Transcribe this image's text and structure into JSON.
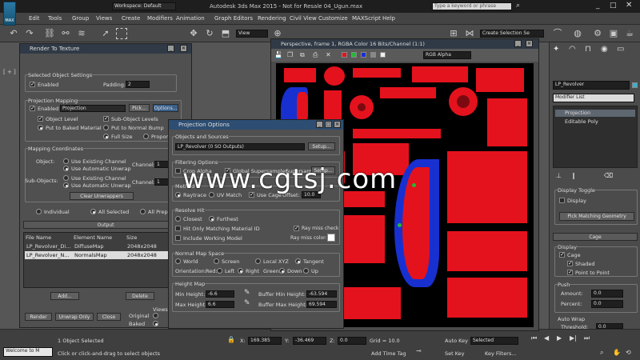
{
  "app": {
    "title": "Autodesk 3ds Max 2015 - Not for Resale   04_Ugun.max",
    "workspace": "Workspace: Default",
    "search_placeholder": "Type a keyword or phrase",
    "logo_text": "MAX"
  },
  "menu": [
    "Edit",
    "Tools",
    "Group",
    "Views",
    "Create",
    "Modifiers",
    "Animation",
    "Graph Editors",
    "Rendering",
    "Civil View",
    "Customize",
    "MAXScript",
    "Help"
  ],
  "toolbar": {
    "view_dropdown": "View",
    "selection_set": "Create Selection Se"
  },
  "rtt": {
    "title": "Render To Texture",
    "selected_settings_label": "Selected Object Settings",
    "enabled_label": "Enabled",
    "padding_label": "Padding:",
    "padding_value": "2",
    "projection_label": "Projection Mapping",
    "projection_enabled": "Enabled",
    "projection_value": "Projection",
    "pick_label": "Pick...",
    "options_label": "Options...",
    "object_level": "Object Level",
    "sub_object_levels": "Sub-Object Levels",
    "put_to_baked": "Put to Baked Material",
    "put_to_normal": "Put to Normal Bump",
    "full_size": "Full Size",
    "proportional": "Proportional",
    "mapping_coords_label": "Mapping Coordinates",
    "object_label": "Object:",
    "subobjects_label": "Sub-Objects:",
    "use_existing_channel": "Use Existing Channel",
    "use_auto_unwrap": "Use Automatic Unwrap",
    "channel_label": "Channel:",
    "channel_value": "1",
    "clear_unwrappers": "Clear Unwrappers",
    "individual": "Individual",
    "all_selected": "All Selected",
    "all_prepared": "All Prepared",
    "output_label": "Output",
    "table_headers": [
      "File Name",
      "Element Name",
      "Size"
    ],
    "table_rows": [
      [
        "LP_Revolver_Di...",
        "DiffuseMap",
        "2048x2048"
      ],
      [
        "LP_Revolver_N...",
        "NormalsMap",
        "2048x2048"
      ]
    ],
    "add_label": "Add...",
    "delete_label": "Delete",
    "views_label": "Views",
    "original_label": "Original",
    "baked_label": "Baked",
    "render_label": "Render",
    "unwrap_only": "Unwrap Only",
    "close_label": "Close"
  },
  "proj": {
    "title": "Projection Options",
    "objects_sources_label": "Objects and Sources",
    "source_value": "LP_Revolver (0 SO Outputs)",
    "setup_label": "Setup...",
    "filtering_label": "Filtering Options",
    "crop_alpha": "Crop Alpha",
    "global_supersampler": "Global Supersampler",
    "supersampler_label": "Supersampler",
    "setup2_label": "Setup...",
    "method_label": "Method",
    "raytrace": "Raytrace",
    "uv_match": "UV Match",
    "use_cage": "Use Cage",
    "offset_label": "Offset:",
    "offset_value": "10.0",
    "resolve_hit_label": "Resolve Hit",
    "closest": "Closest",
    "furthest": "Furthest",
    "hit_only_matching": "Hit Only Matching Material ID",
    "ray_miss_check": "Ray miss check",
    "include_working_model": "Include Working Model",
    "ray_miss_color": "Ray miss color:",
    "normal_map_space_label": "Normal Map Space",
    "world": "World",
    "screen": "Screen",
    "local_xyz": "Local XYZ",
    "tangent": "Tangent",
    "orientation_label": "Orientation:",
    "red_label": "Red:",
    "left_label": "Left",
    "right_label": "Right",
    "green_label": "Green:",
    "down_label": "Down",
    "up_label": "Up",
    "height_map_label": "Height Map",
    "min_height_label": "Min Height:",
    "min_height_value": "-6.6",
    "max_height_label": "Max Height:",
    "max_height_value": "6.6",
    "buffer_min_label": "Buffer Min Height:",
    "buffer_min_value": "-63.594",
    "buffer_max_label": "Buffer Max Height:",
    "buffer_max_value": "69.594"
  },
  "framebuffer": {
    "title": "Perspective, frame 1, RGBA Color 16 Bits/Channel (1:1)",
    "channel_value": "RGB Alpha"
  },
  "cmd": {
    "object_name": "LP_Revolver",
    "modifier_list": "Modifier List",
    "stack": [
      "Projection",
      "Editable Poly"
    ],
    "display_toggle_label": "Display Toggle",
    "display_item": "Display",
    "pick_matching": "Pick Matching Geometry",
    "cage_header": "Cage",
    "display_label": "Display",
    "cage_item": "Cage",
    "shaded_item": "Shaded",
    "point_to_point": "Point to Point",
    "push_label": "Push",
    "amount_label": "Amount:",
    "amount_value": "0.0",
    "percent_label": "Percent:",
    "percent_value": "0.0",
    "auto_wrap_label": "Auto Wrap",
    "threshold_label": "Threshold:",
    "threshold_value": "0.0"
  },
  "status": {
    "welcome": "Welcome to M",
    "selected": "1 Object Selected",
    "prompt": "Click or click-and-drag to select objects",
    "x_label": "X:",
    "x_value": "169.385",
    "y_label": "Y:",
    "y_value": "-36.469",
    "z_label": "Z:",
    "z_value": "0.0",
    "grid_label": "Grid = 10.0",
    "add_time_tag": "Add Time Tag",
    "auto_key": "Auto Key",
    "selected_dropdown": "Selected",
    "set_key": "Set Key",
    "key_filters": "Key Filters..."
  },
  "watermark": "www.cgtsj.com",
  "colors": {
    "accent": "#303a46",
    "red": "#e4121d",
    "blue": "#1830d0",
    "green": "#22bb33"
  }
}
